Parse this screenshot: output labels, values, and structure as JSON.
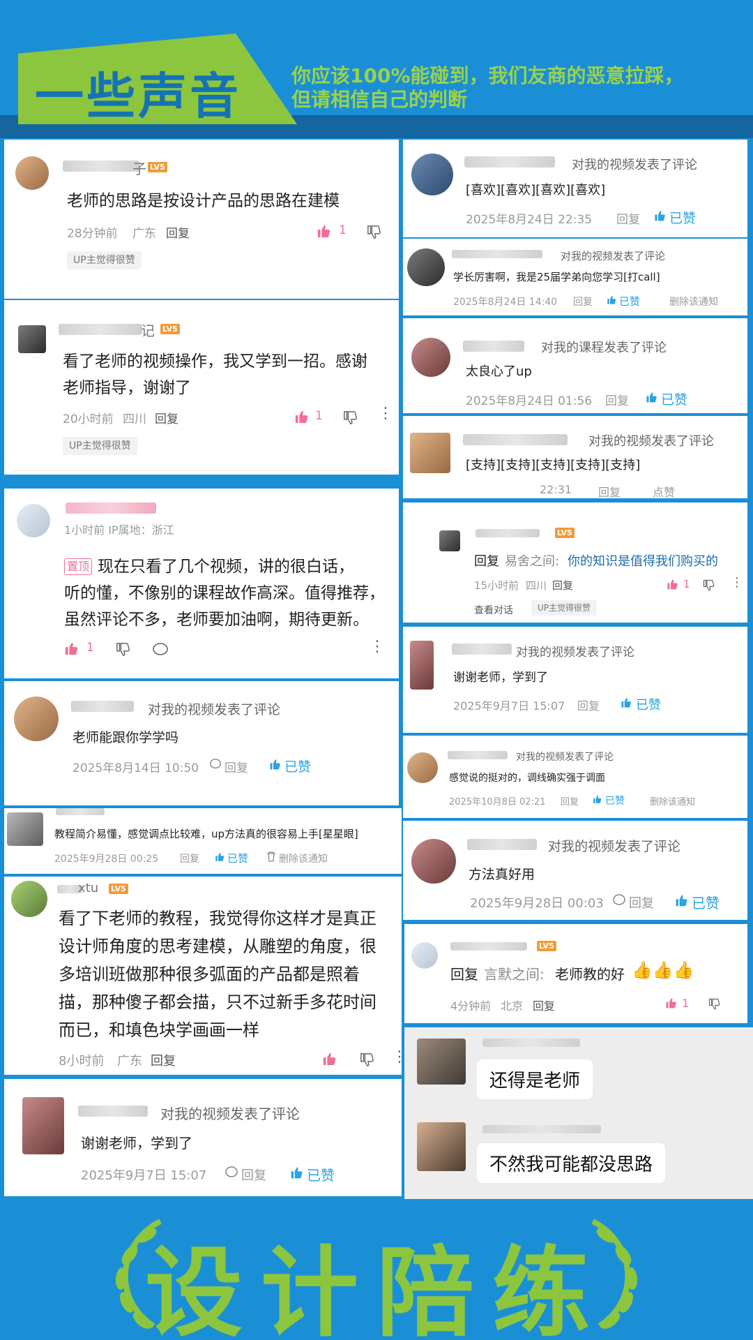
{
  "header": {
    "title": "一些声音",
    "subtitle_line1": "你应该100%能碰到，我们友商的恶意拉踩，",
    "subtitle_line2": "但请相信自己的判断"
  },
  "common": {
    "reply": "回复",
    "liked": "已赞",
    "like": "点赞",
    "up_liked_tag": "UP主觉得很赞",
    "lv": "LV5",
    "delete_notice": "删除该通知",
    "video_comment_action": "对我的视频发表了评论",
    "course_comment_action": "对我的课程发表了评论",
    "view_dialog": "查看对话"
  },
  "left": {
    "c1": {
      "name_suffix": "子",
      "text": "老师的思路是按设计产品的思路在建模",
      "time": "28分钟前",
      "location": "广东",
      "likes": "1"
    },
    "c2": {
      "name_suffix": "记",
      "text_line1": "看了老师的视频操作，我又学到一招。感谢",
      "text_line2": "老师指导，谢谢了",
      "time": "20小时前",
      "location": "四川",
      "likes": "1"
    },
    "c3": {
      "meta": "1小时前  IP属地：浙江",
      "pin": "置顶",
      "text_line1": "现在只看了几个视频，讲的很白话，",
      "text_line2": "听的懂，不像别的课程故作高深。值得推荐，",
      "text_line3": "虽然评论不多，老师要加油啊，期待更新。",
      "likes": "1"
    },
    "c4": {
      "text": "老师能跟你学学吗",
      "time": "2025年8月14日 10:50"
    },
    "c5": {
      "text": "教程简介易懂，感觉调点比较难，up方法真的很容易上手[星星眼]",
      "time": "2025年9月28日 00:25"
    },
    "c6": {
      "name_suffix": "xtu",
      "text_line1": "看了下老师的教程，我觉得你这样才是真正",
      "text_line2": "设计师角度的思考建模，从雕塑的角度，很",
      "text_line3": "多培训班做那种很多弧面的产品都是照着",
      "text_line4": "描，那种傻子都会描，只不过新手多花时间",
      "text_line5": "而已，和填色块学画画一样",
      "time": "8小时前",
      "location": "广东"
    },
    "c7": {
      "text": "谢谢老师，学到了",
      "time": "2025年9月7日 15:07"
    }
  },
  "right": {
    "r1": {
      "text": "[喜欢][喜欢][喜欢][喜欢]",
      "time": "2025年8月24日 22:35"
    },
    "r2": {
      "text": "学长厉害啊，我是25届学弟向您学习[打call]",
      "time": "2025年8月24日 14:40"
    },
    "r3": {
      "text": "太良心了up",
      "time": "2025年8月24日 01:56"
    },
    "r4": {
      "text": "[支持][支持][支持][支持][支持]",
      "time": "22:31"
    },
    "r5": {
      "reply_to": "易舍之间:",
      "text": "你的知识是值得我们购买的",
      "time": "15小时前",
      "location": "四川",
      "likes": "1"
    },
    "r6": {
      "text": "谢谢老师，学到了",
      "time": "2025年9月7日 15:07"
    },
    "r7": {
      "text": "感觉说的挺对的，调线确实强于调面",
      "time": "2025年10月8日 02:21"
    },
    "r8": {
      "text": "方法真好用",
      "time": "2025年9月28日 00:03"
    },
    "r9": {
      "reply_to": "言默之间:",
      "text": "老师教的好",
      "emoji": "👍👍👍",
      "time": "4分钟前",
      "location": "北京",
      "likes": "1"
    }
  },
  "chat": {
    "msg1": "还得是老师",
    "msg2": "不然我可能都没思路"
  },
  "footer": {
    "title": "设计陪练"
  },
  "colors": {
    "brand_blue": "#1b8fd6",
    "accent_green": "#8cc63f",
    "like_pink": "#f26e94",
    "liked_blue": "#2aa3e0"
  }
}
